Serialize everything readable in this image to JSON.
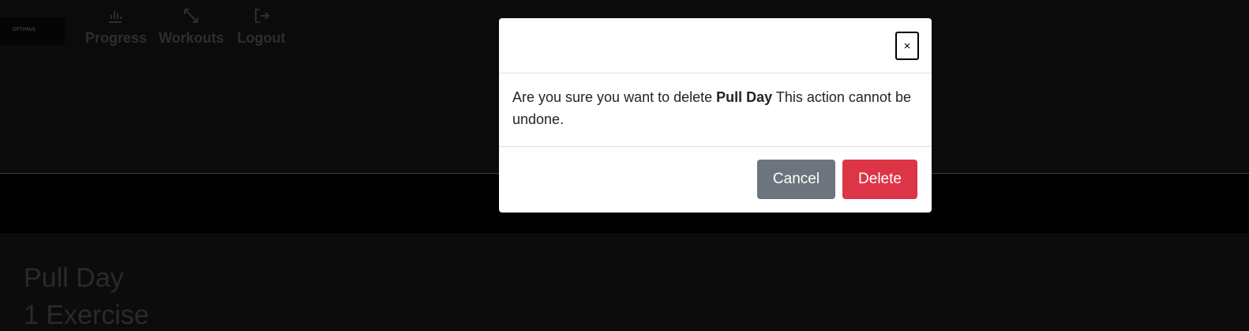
{
  "nav": {
    "logo_text": "OPTIMUS",
    "items": [
      {
        "label": "Progress",
        "icon": "chart-icon"
      },
      {
        "label": "Workouts",
        "icon": "expand-arrows-icon"
      },
      {
        "label": "Logout",
        "icon": "logout-icon"
      }
    ]
  },
  "page": {
    "workout_title": "Pull Day",
    "workout_subtitle": "1 Exercise"
  },
  "modal": {
    "close_label": "×",
    "message_prefix": "Are you sure you want to delete ",
    "item_name": "Pull Day",
    "message_suffix": " This action cannot be undone.",
    "cancel_label": "Cancel",
    "delete_label": "Delete"
  },
  "colors": {
    "cancel_button": "#6c757d",
    "delete_button": "#dc3545",
    "backdrop": "#0b0b0b"
  }
}
